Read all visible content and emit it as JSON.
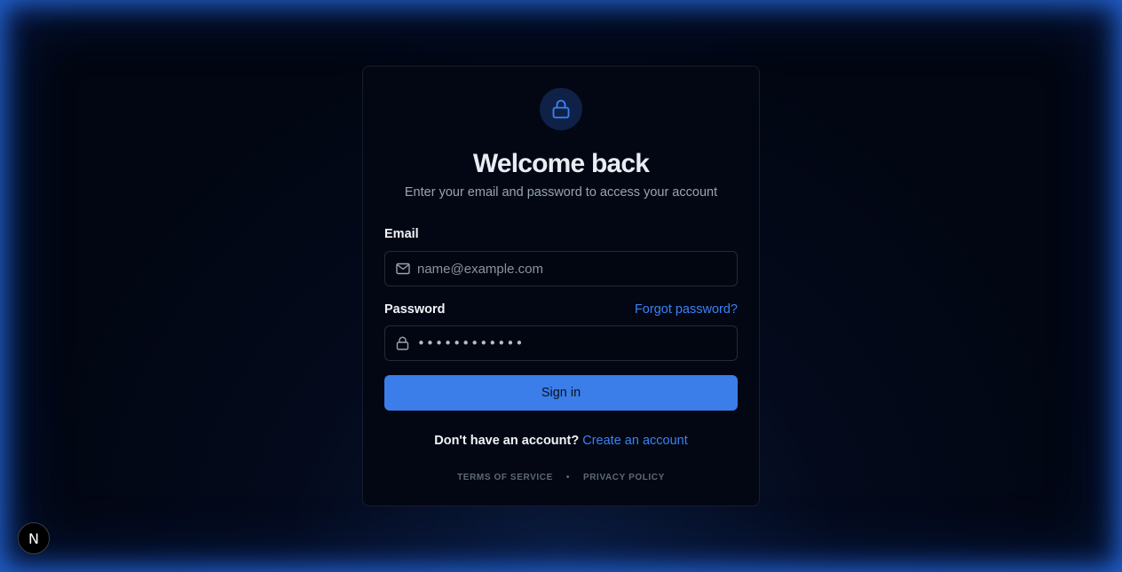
{
  "login": {
    "title": "Welcome back",
    "subtitle": "Enter your email and password to access your account",
    "email_label": "Email",
    "email_placeholder": "name@example.com",
    "email_value": "",
    "password_label": "Password",
    "forgot_link": "Forgot password?",
    "password_masked": "••••••••••••",
    "signin_label": "Sign in",
    "no_account_text": "Don't have an account?",
    "create_account_link": "Create an account",
    "terms_link": "TERMS OF SERVICE",
    "separator": "•",
    "privacy_link": "PRIVACY POLICY"
  },
  "dev_badge": {
    "label": "N",
    "icon": "nextjs-logo-icon"
  },
  "icons": {
    "header": "lock-icon",
    "email_field": "mail-icon",
    "password_field": "lock-icon"
  },
  "colors": {
    "accent": "#3b82f6",
    "button": "#3b7ee9",
    "card_bg": "#020713",
    "badge_bg": "#0f2147"
  }
}
